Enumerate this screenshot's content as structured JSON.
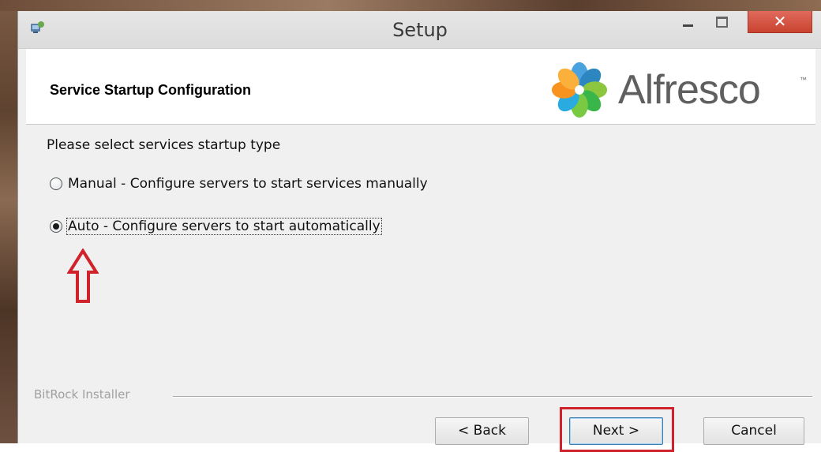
{
  "window": {
    "title": "Setup",
    "close_glyph": "✕"
  },
  "header": {
    "title": "Service Startup Configuration",
    "logo_text": "Alfresco",
    "logo_tm": "™"
  },
  "content": {
    "prompt": "Please select services startup type",
    "options": [
      {
        "label": "Manual - Configure servers to start services manually",
        "selected": false
      },
      {
        "label": "Auto - Configure servers to start automatically",
        "selected": true
      }
    ]
  },
  "footer": {
    "brand": "BitRock Installer"
  },
  "buttons": {
    "back": "< Back",
    "next": "Next >",
    "cancel": "Cancel"
  },
  "colors": {
    "annotation": "#d0222b",
    "close_button": "#c9432f"
  },
  "icons": {
    "app": "installer-app-icon",
    "minimize": "minimize-icon",
    "maximize": "maximize-icon",
    "close": "close-icon",
    "logo": "alfresco-flower-logo",
    "annotation": "up-arrow-annotation-icon"
  }
}
